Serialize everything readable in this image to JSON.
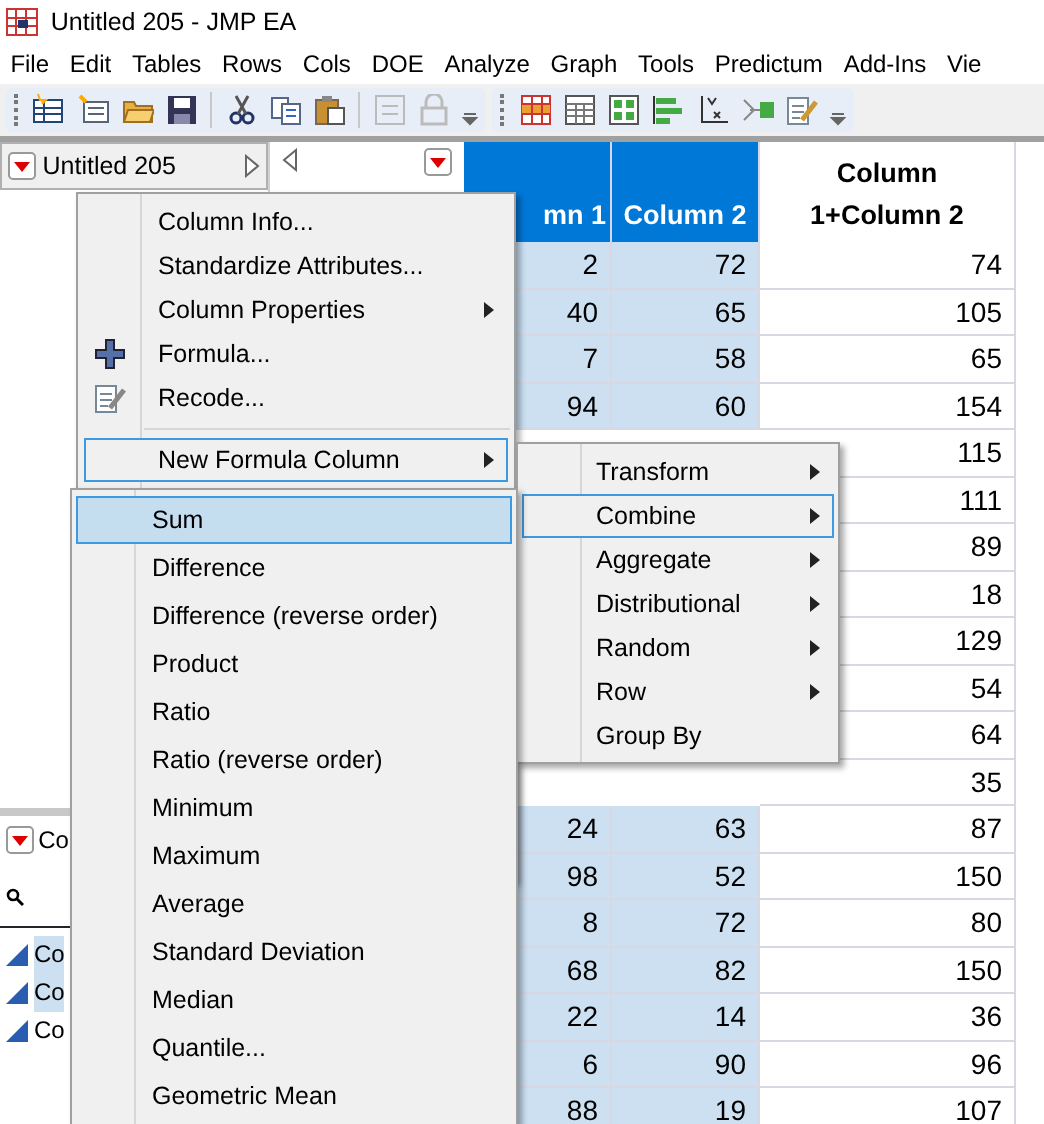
{
  "window": {
    "title": "Untitled 205 - JMP EA"
  },
  "menu_bar": [
    "File",
    "Edit",
    "Tables",
    "Rows",
    "Cols",
    "DOE",
    "Analyze",
    "Graph",
    "Tools",
    "Predictum",
    "Add-Ins",
    "Vie"
  ],
  "table_panel": {
    "title": "Untitled 205"
  },
  "columns_panel": {
    "title": "Co",
    "columns": [
      {
        "name": "Co",
        "selected": true
      },
      {
        "name": "Co",
        "selected": true
      },
      {
        "name": "Co",
        "selected": false
      }
    ]
  },
  "data_grid": {
    "columns": [
      {
        "header": "mn 1",
        "selected": true
      },
      {
        "header": "Column 2",
        "selected": true
      },
      {
        "header": "Column 1+Column 2",
        "selected": false
      }
    ],
    "rows": [
      [
        "2",
        "72",
        "74"
      ],
      [
        "40",
        "65",
        "105"
      ],
      [
        "7",
        "58",
        "65"
      ],
      [
        "94",
        "60",
        "154"
      ],
      [
        null,
        null,
        "115"
      ],
      [
        null,
        null,
        "111"
      ],
      [
        null,
        null,
        "89"
      ],
      [
        null,
        null,
        "18"
      ],
      [
        null,
        null,
        "129"
      ],
      [
        null,
        null,
        "54"
      ],
      [
        null,
        null,
        "64"
      ],
      [
        null,
        null,
        "35"
      ],
      [
        "24",
        "63",
        "87"
      ],
      [
        "98",
        "52",
        "150"
      ],
      [
        "8",
        "72",
        "80"
      ],
      [
        "68",
        "82",
        "150"
      ],
      [
        "22",
        "14",
        "36"
      ],
      [
        "6",
        "90",
        "96"
      ],
      [
        "88",
        "19",
        "107"
      ]
    ]
  },
  "context_menu": {
    "items": [
      {
        "kind": "item",
        "label": "Column Info...",
        "submenu": false,
        "highlighted": false
      },
      {
        "kind": "item",
        "label": "Standardize Attributes...",
        "submenu": false,
        "highlighted": false
      },
      {
        "kind": "item",
        "label": "Column Properties",
        "submenu": true,
        "highlighted": false
      },
      {
        "kind": "item",
        "label": "Formula...",
        "submenu": false,
        "highlighted": false
      },
      {
        "kind": "item",
        "label": "Recode...",
        "submenu": false,
        "highlighted": false
      },
      {
        "kind": "separator"
      },
      {
        "kind": "item",
        "label": "New Formula Column",
        "submenu": true,
        "highlighted": true
      }
    ]
  },
  "formula_submenu": {
    "items": [
      {
        "label": "Transform",
        "submenu": true,
        "highlighted": false
      },
      {
        "label": "Combine",
        "submenu": true,
        "highlighted": true
      },
      {
        "label": "Aggregate",
        "submenu": true,
        "highlighted": false
      },
      {
        "label": "Distributional",
        "submenu": true,
        "highlighted": false
      },
      {
        "label": "Random",
        "submenu": true,
        "highlighted": false
      },
      {
        "label": "Row",
        "submenu": true,
        "highlighted": false
      },
      {
        "label": "Group By",
        "submenu": false,
        "highlighted": false
      }
    ]
  },
  "combine_submenu": {
    "items": [
      {
        "label": "Sum",
        "highlighted": true
      },
      {
        "label": "Difference",
        "highlighted": false
      },
      {
        "label": "Difference (reverse order)",
        "highlighted": false
      },
      {
        "label": "Product",
        "highlighted": false
      },
      {
        "label": "Ratio",
        "highlighted": false
      },
      {
        "label": "Ratio (reverse order)",
        "highlighted": false
      },
      {
        "label": "Minimum",
        "highlighted": false
      },
      {
        "label": "Maximum",
        "highlighted": false
      },
      {
        "label": "Average",
        "highlighted": false
      },
      {
        "label": "Standard Deviation",
        "highlighted": false
      },
      {
        "label": "Median",
        "highlighted": false
      },
      {
        "label": "Quantile...",
        "highlighted": false
      },
      {
        "label": "Geometric Mean",
        "highlighted": false
      }
    ]
  }
}
